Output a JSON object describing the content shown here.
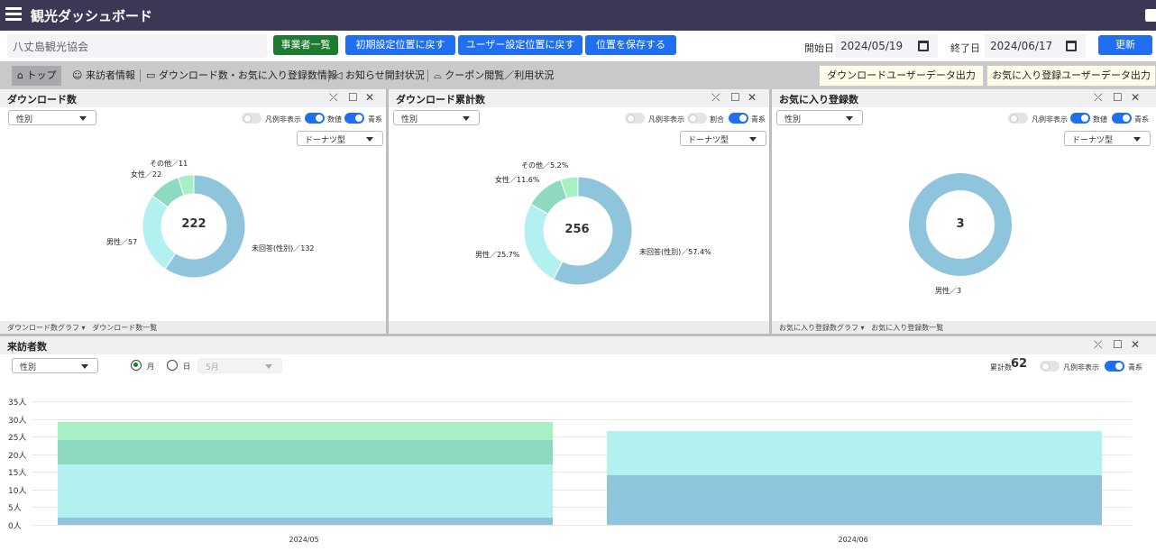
{
  "app": {
    "title": "観光ダッシュボード"
  },
  "toolbar": {
    "organization": "八丈島観光協会",
    "buttons": [
      "事業者一覧",
      "初期設定位置に戻す",
      "ユーザー設定位置に戻す",
      "位置を保存する"
    ],
    "start_label": "開始日",
    "start_date": "2024/05/19",
    "end_label": "終了日",
    "end_date": "2024/06/17",
    "update_label": "更新"
  },
  "nav": {
    "items": [
      "トップ",
      "来訪者情報",
      "ダウンロード数・お気に入り登録数情報",
      "お知らせ開封状況",
      "クーポン閲覧／利用状況"
    ],
    "export_buttons": [
      "ダウンロードユーザーデータ出力",
      "お気に入り登録ユーザーデータ出力"
    ]
  },
  "panels": [
    {
      "title": "ダウンロード数",
      "select": "性別",
      "toggles": [
        "凡例非表示",
        "数値",
        "青系"
      ],
      "toggle_states": [
        false,
        true,
        true
      ],
      "chart_type_select": "ドーナツ型",
      "footer": [
        "ダウンロード数グラフ",
        "ダウンロード数一覧"
      ]
    },
    {
      "title": "ダウンロード累計数",
      "select": "性別",
      "toggles": [
        "凡例非表示",
        "割合",
        "青系"
      ],
      "toggle_states": [
        false,
        false,
        true
      ],
      "chart_type_select": "ドーナツ型",
      "footer": []
    },
    {
      "title": "お気に入り登録数",
      "select": "性別",
      "toggles": [
        "凡例非表示",
        "数値",
        "青系"
      ],
      "toggle_states": [
        false,
        true,
        true
      ],
      "chart_type_select": "ドーナツ型",
      "footer": [
        "お気に入り登録数グラフ",
        "お気に入り登録数一覧"
      ]
    }
  ],
  "visitors": {
    "title": "来訪者数",
    "select": "性別",
    "radio_month": "月",
    "radio_day": "日",
    "month_select": "5月",
    "total_label": "累計数",
    "total_value": "62",
    "toggles": [
      "凡例非表示",
      "青系"
    ],
    "toggle_states": [
      false,
      true
    ]
  },
  "colors": {
    "unanswered": "#8ec4dc",
    "male": "#b3f1f1",
    "female": "#8ddac0",
    "other": "#a6f0c4"
  },
  "chart_data": [
    {
      "type": "pie",
      "title": "ダウンロード数",
      "center_label": "222",
      "slices": [
        {
          "label": "未回答(性別)／132",
          "value": 132
        },
        {
          "label": "男性／57",
          "value": 57
        },
        {
          "label": "女性／22",
          "value": 22
        },
        {
          "label": "その他／11",
          "value": 11
        }
      ]
    },
    {
      "type": "pie",
      "title": "ダウンロード累計数",
      "center_label": "256",
      "slices": [
        {
          "label": "未回答(性別)／57.4%",
          "value": 57.4
        },
        {
          "label": "男性／25.7%",
          "value": 25.7
        },
        {
          "label": "女性／11.6%",
          "value": 11.6
        },
        {
          "label": "その他／5.2%",
          "value": 5.2
        }
      ]
    },
    {
      "type": "pie",
      "title": "お気に入り登録数",
      "center_label": "3",
      "slices": [
        {
          "label": "男性／3",
          "value": 3
        }
      ]
    },
    {
      "type": "bar",
      "title": "来訪者数",
      "stacked": true,
      "categories": [
        "2024/05",
        "2024/06"
      ],
      "series": [
        {
          "values": [
            2,
            14
          ]
        },
        {
          "values": [
            15,
            12.5
          ]
        },
        {
          "values": [
            7,
            0
          ]
        },
        {
          "values": [
            5,
            0
          ]
        }
      ],
      "ylim": [
        0,
        35
      ],
      "yticks": [
        "0人",
        "5人",
        "10人",
        "15人",
        "20人",
        "25人",
        "30人",
        "35人"
      ]
    }
  ]
}
